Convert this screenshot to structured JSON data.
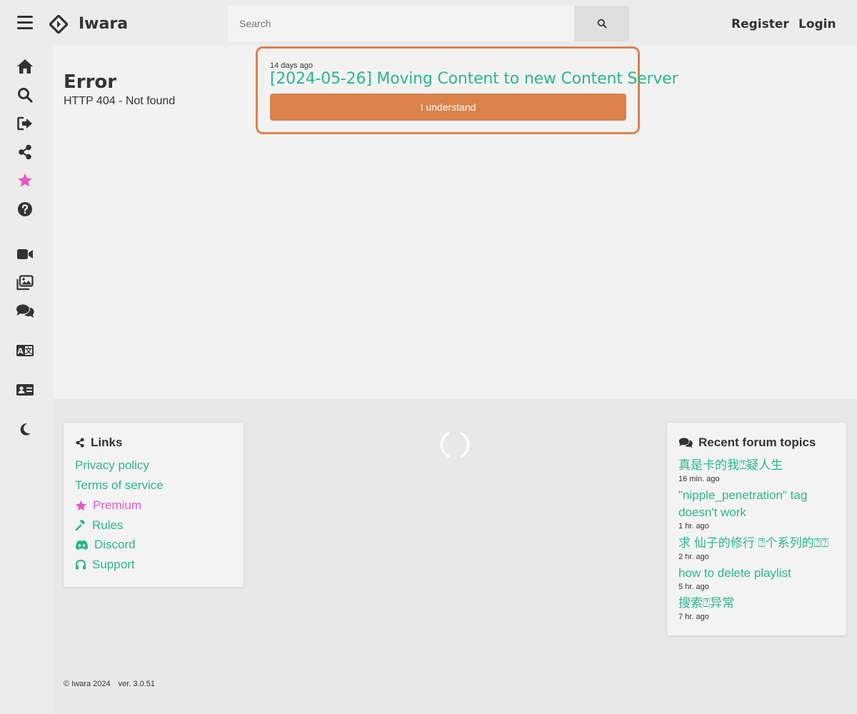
{
  "header": {
    "logo_text": "Iwara",
    "search_placeholder": "Search",
    "register_label": "Register",
    "login_label": "Login"
  },
  "sidebar": {
    "items": [
      {
        "icon": "home-icon"
      },
      {
        "icon": "search-icon"
      },
      {
        "icon": "sign-out-icon"
      },
      {
        "icon": "share-icon"
      },
      {
        "icon": "star-icon"
      },
      {
        "icon": "help-icon"
      },
      {
        "icon": "video-icon"
      },
      {
        "icon": "images-icon"
      },
      {
        "icon": "forum-icon"
      },
      {
        "icon": "language-icon"
      },
      {
        "icon": "id-card-icon"
      },
      {
        "icon": "moon-icon"
      }
    ]
  },
  "main": {
    "error_title": "Error",
    "error_message": "HTTP 404 - Not found"
  },
  "notice": {
    "age": "14 days ago",
    "title": "[2024-05-26] Moving Content to new Content Server",
    "button_label": "I understand"
  },
  "links_card": {
    "title": "Links",
    "items": [
      {
        "label": "Privacy policy"
      },
      {
        "label": "Terms of service"
      },
      {
        "label": "Premium"
      },
      {
        "label": "Rules"
      },
      {
        "label": "Discord"
      },
      {
        "label": "Support"
      }
    ]
  },
  "forum_card": {
    "title": "Recent forum topics",
    "topics": [
      {
        "title": "真是卡的我⍰疑人生",
        "age": "16 min. ago"
      },
      {
        "title": "\"nipple_penetration\" tag doesn't work",
        "age": "1 hr. ago"
      },
      {
        "title": "求 仙子的修行 ⍰个系列的⍰⍰",
        "age": "2 hr. ago"
      },
      {
        "title": "how to delete playlist",
        "age": "5 hr. ago"
      },
      {
        "title": "搜索⍰异常",
        "age": "7 hr. ago"
      }
    ]
  },
  "footer": {
    "copyright": "© Iwara 2024",
    "version": "ver. 3.0.51"
  },
  "colors": {
    "accent": "#2bb58f",
    "notice_orange": "#d9824b",
    "premium_pink": "#e659c2"
  }
}
